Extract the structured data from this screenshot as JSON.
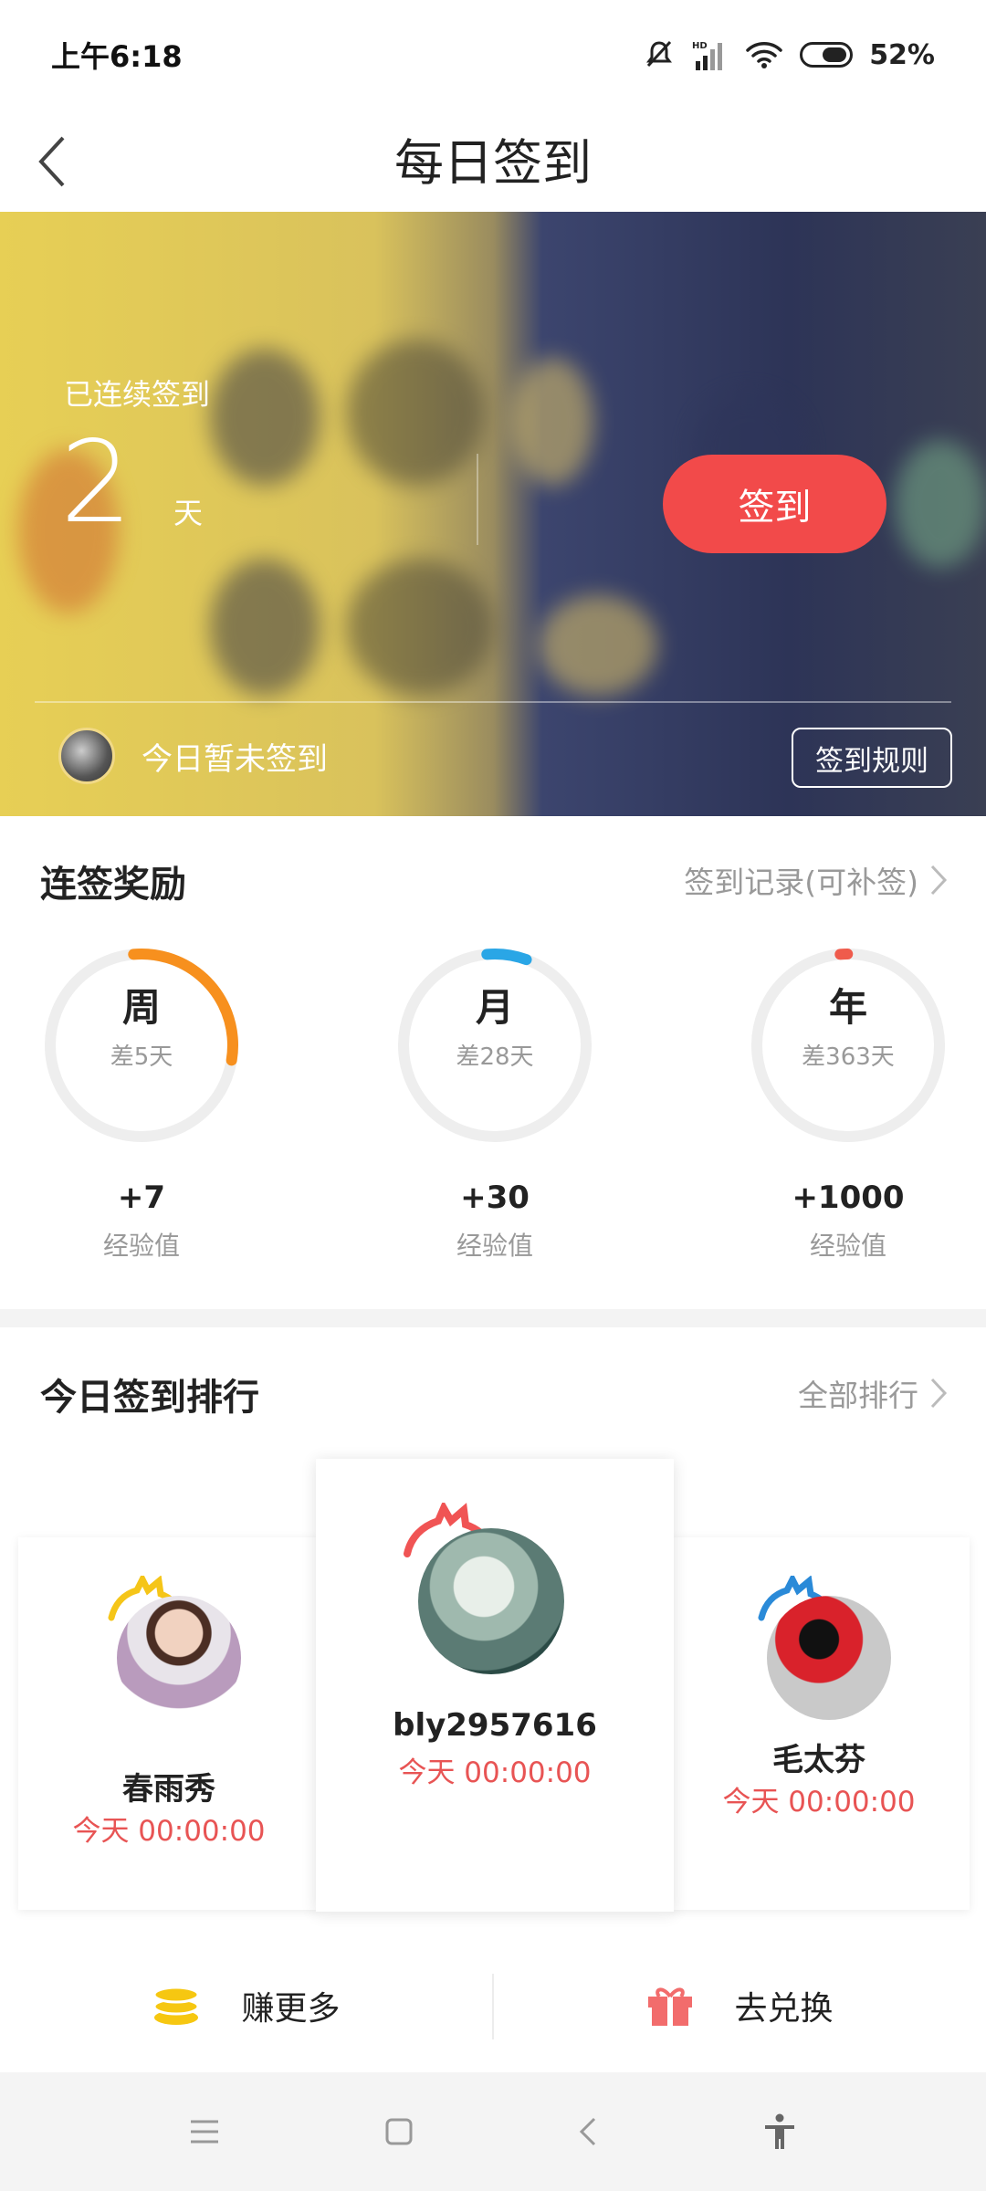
{
  "status_bar": {
    "time": "上午6:18",
    "battery": "52%"
  },
  "header": {
    "title": "每日签到"
  },
  "hero": {
    "streak_label": "已连续签到",
    "streak_days": "2",
    "streak_unit": "天",
    "checkin_button": "签到",
    "today_status": "今日暂未签到",
    "rules_button": "签到规则"
  },
  "rewards": {
    "title": "连签奖励",
    "record_link": "签到记录(可补签)",
    "items": [
      {
        "period": "周",
        "remaining": "差5天",
        "points": "+7",
        "unit": "经验值",
        "progress": 0.29,
        "color": "#f7901e"
      },
      {
        "period": "月",
        "remaining": "差28天",
        "points": "+30",
        "unit": "经验值",
        "progress": 0.07,
        "color": "#2aa6e6"
      },
      {
        "period": "年",
        "remaining": "差363天",
        "points": "+1000",
        "unit": "经验值",
        "progress": 0.005,
        "color": "#ef5b4c"
      }
    ]
  },
  "ranking": {
    "title": "今日签到排行",
    "all_link": "全部排行",
    "entries": [
      {
        "name": "春雨秀",
        "time": "今天 00:00:00",
        "crown": "gold"
      },
      {
        "name": "bly2957616",
        "time": "今天 00:00:00",
        "crown": "red"
      },
      {
        "name": "毛太芬",
        "time": "今天 00:00:00",
        "crown": "blue"
      }
    ]
  },
  "bottom_actions": {
    "earn": "赚更多",
    "redeem": "去兑换"
  }
}
